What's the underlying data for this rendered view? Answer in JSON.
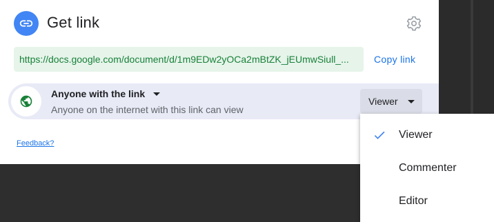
{
  "dialog": {
    "title": "Get link",
    "link_icon": "link-icon",
    "settings_icon": "gear-icon",
    "url": "https://docs.google.com/document/d/1m9EDw2yOCa2mBtZK_jEUmwSiull_...",
    "copy_label": "Copy link",
    "access": {
      "icon": "globe-icon",
      "scope_label": "Anyone with the link",
      "description": "Anyone on the internet with this link can view",
      "role_label": "Viewer"
    },
    "feedback_label": "Feedback?"
  },
  "role_menu": {
    "selected": "Viewer",
    "items": [
      {
        "label": "Viewer",
        "checked": true
      },
      {
        "label": "Commenter",
        "checked": false
      },
      {
        "label": "Editor",
        "checked": false
      }
    ]
  },
  "colors": {
    "accent_blue": "#1a73e8",
    "link_green": "#188038",
    "url_bg": "#e6f4ea",
    "row_bg": "#e8eaf6",
    "backdrop": "#2e2e2e"
  }
}
